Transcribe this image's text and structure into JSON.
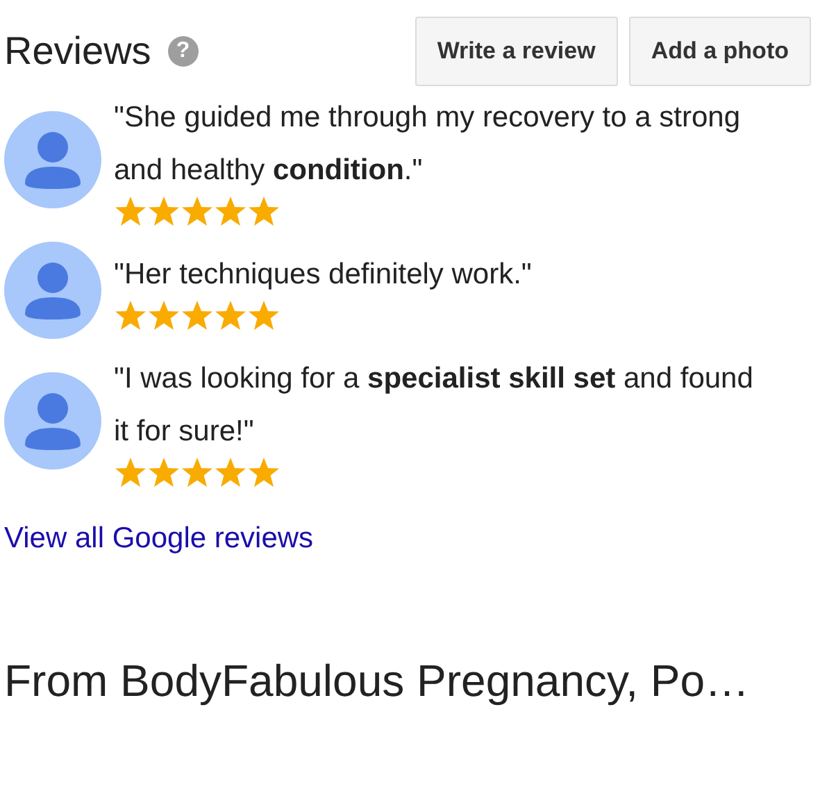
{
  "header": {
    "title": "Reviews",
    "help": "?",
    "buttons": [
      "Write a review",
      "Add a photo"
    ]
  },
  "reviews": [
    {
      "text": "\"She guided me through my recovery to a strong and healthy **condition**.\"",
      "stars": 5
    },
    {
      "text": "\"Her techniques definitely work.\"",
      "stars": 5
    },
    {
      "text": "\"I was looking for a **specialist skill set** and found it for sure!\"",
      "stars": 5
    }
  ],
  "link": "View all Google reviews",
  "section_title": "From BodyFabulous Pregnancy, Po…"
}
